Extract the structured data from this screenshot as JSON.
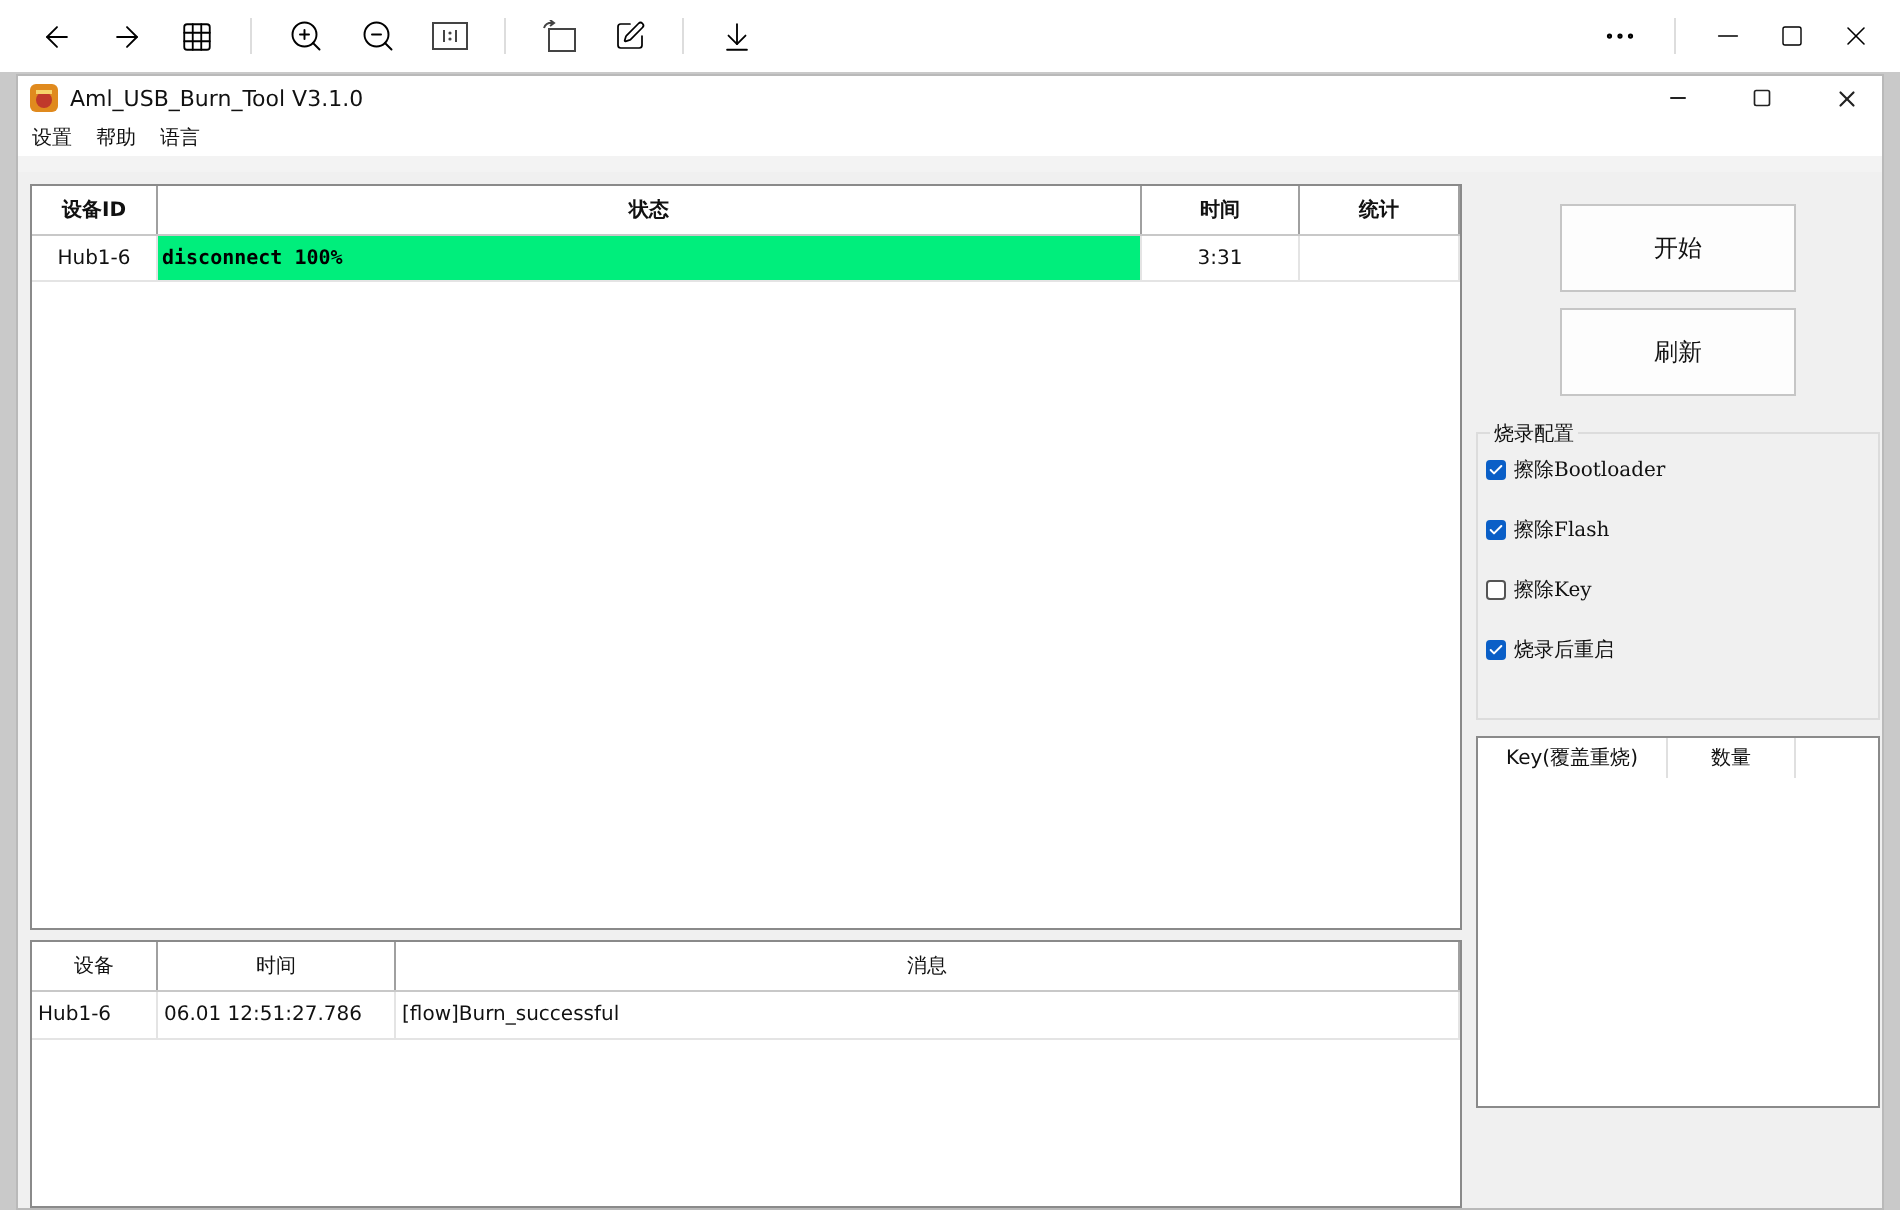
{
  "window": {
    "title": "Aml_USB_Burn_Tool V3.1.0"
  },
  "menu": [
    "设置",
    "帮助",
    "语言"
  ],
  "device_table": {
    "columns": [
      "设备ID",
      "状态",
      "时间",
      "统计"
    ],
    "rows": [
      {
        "device": "Hub1-6",
        "status": "disconnect 100%",
        "level": 1,
        "time": "3:31",
        "count": ""
      }
    ]
  },
  "log_table": {
    "columns": [
      "设备",
      "时间",
      "消息"
    ],
    "rows": [
      {
        "device": "Hub1-6",
        "time": "06.01 12:51:27.786",
        "message": "[flow]Burn_successful"
      }
    ]
  },
  "buttons": [
    "开始",
    "刷新"
  ],
  "burn_config": {
    "title": "烧录配置",
    "options": [
      {
        "label": "擦除Bootloader",
        "checked": true
      },
      {
        "label": "擦除Flash",
        "checked": true
      },
      {
        "label": "擦除Key",
        "checked": false
      },
      {
        "label": "烧录后重启",
        "checked": true
      }
    ]
  },
  "key_table": {
    "columns": [
      "Key(覆盖重烧)",
      "数量"
    ]
  }
}
